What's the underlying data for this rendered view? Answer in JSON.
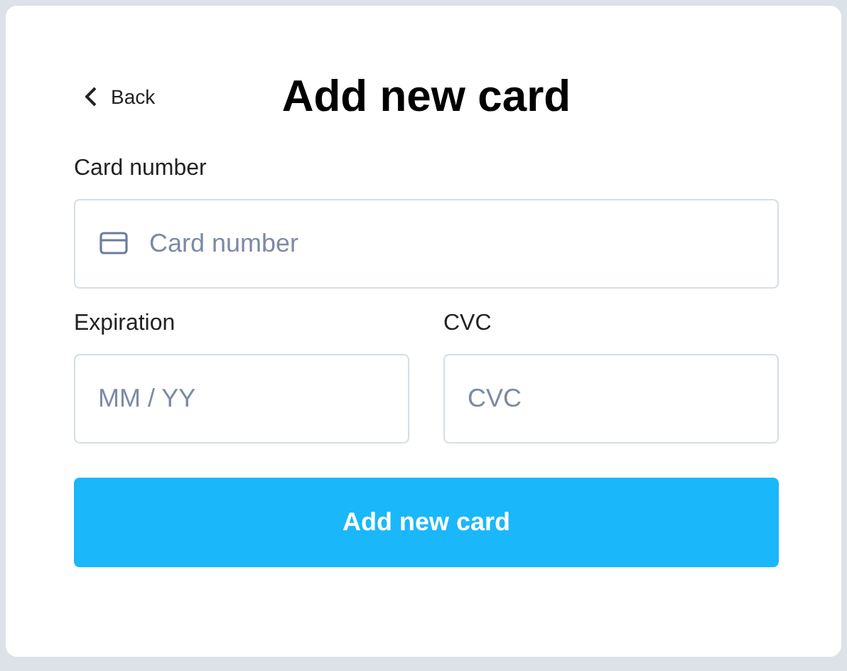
{
  "header": {
    "back": "Back",
    "title": "Add new card"
  },
  "fields": [
    {
      "label": "Card number",
      "placeholder": "Card number",
      "icon": true
    }
  ],
  "row": [
    {
      "label": "Expiration",
      "placeholder": "MM / YY"
    },
    {
      "label": "CVC",
      "placeholder": "CVC"
    }
  ],
  "submit": "Add new card"
}
